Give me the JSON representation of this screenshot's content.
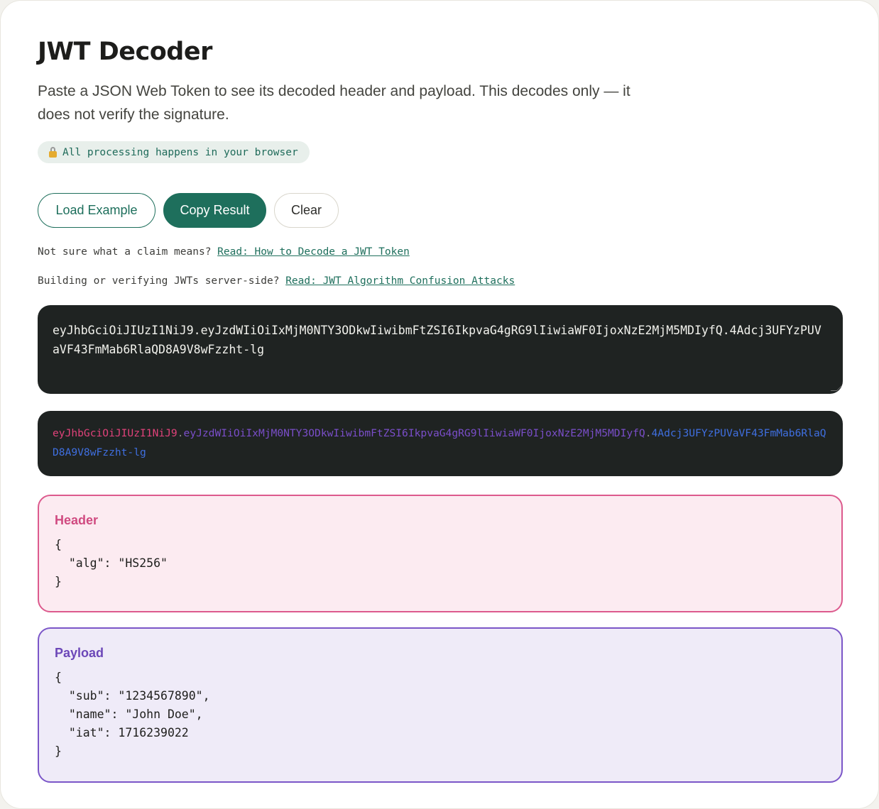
{
  "page": {
    "title": "JWT Decoder",
    "subtitle": "Paste a JSON Web Token to see its decoded header and payload. This decodes only — it does not verify the signature.",
    "privacy_badge": "All processing happens in your browser"
  },
  "toolbar": {
    "load_example_label": "Load Example",
    "copy_result_label": "Copy Result",
    "clear_label": "Clear"
  },
  "hints": [
    {
      "text": "Not sure what a claim means?",
      "link_text": "Read: How to Decode a JWT Token"
    },
    {
      "text": "Building or verifying JWTs server-side?",
      "link_text": "Read: JWT Algorithm Confusion Attacks"
    }
  ],
  "token": {
    "raw": "eyJhbGciOiJIUzI1NiJ9.eyJzdWIiOiIxMjM0NTY3ODkwIiwibmFtZSI6IkpvaG4gRG9lIiwiaWF0IjoxNzE2MjM5MDIyfQ.4Adcj3UFYzPUVaVF43FmMab6RlaQD8A9V8wFzzht-lg",
    "header_part": "eyJhbGciOiJIUzI1NiJ9",
    "payload_part": "eyJzdWIiOiIxMjM0NTY3ODkwIiwibmFtZSI6IkpvaG4gRG9lIiwiaWF0IjoxNzE2MjM5MDIyfQ",
    "signature_part": "4Adcj3UFYzPUVaVF43FmMab6RlaQD8A9V8wFzzht-lg",
    "separator": "."
  },
  "header_panel": {
    "title": "Header",
    "json": "{\n  \"alg\": \"HS256\"\n}"
  },
  "payload_panel": {
    "title": "Payload",
    "json": "{\n  \"sub\": \"1234567890\",\n  \"name\": \"John Doe\",\n  \"iat\": 1716239022\n}"
  },
  "colors": {
    "accent": "#1e6f5c",
    "header_segment": "#e0427a",
    "payload_segment": "#7a4ec9",
    "signature_segment": "#3f6fe0"
  },
  "icons": {
    "privacy_badge_icon": "lock-icon"
  }
}
